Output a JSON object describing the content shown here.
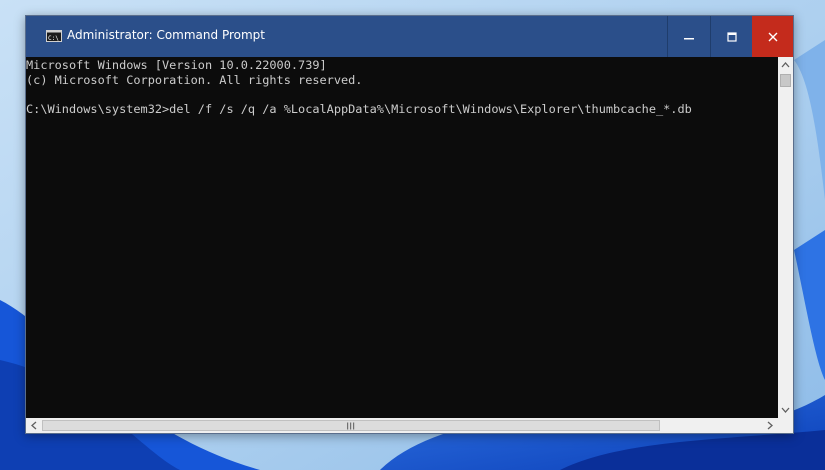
{
  "window": {
    "title": "Administrator: Command Prompt",
    "icon": "cmd-icon",
    "buttons": {
      "minimize": "minimize-icon",
      "maximize": "maximize-icon",
      "close": "close-icon"
    }
  },
  "console": {
    "lines": [
      "Microsoft Windows [Version 10.0.22000.739]",
      "(c) Microsoft Corporation. All rights reserved.",
      "",
      "C:\\Windows\\system32>del /f /s /q /a %LocalAppData%\\Microsoft\\Windows\\Explorer\\thumbcache_*.db"
    ]
  },
  "colors": {
    "titlebar": "#2b4f8a",
    "close_button": "#c42b1c",
    "console_background": "#0c0c0c",
    "console_text": "#cccccc"
  }
}
